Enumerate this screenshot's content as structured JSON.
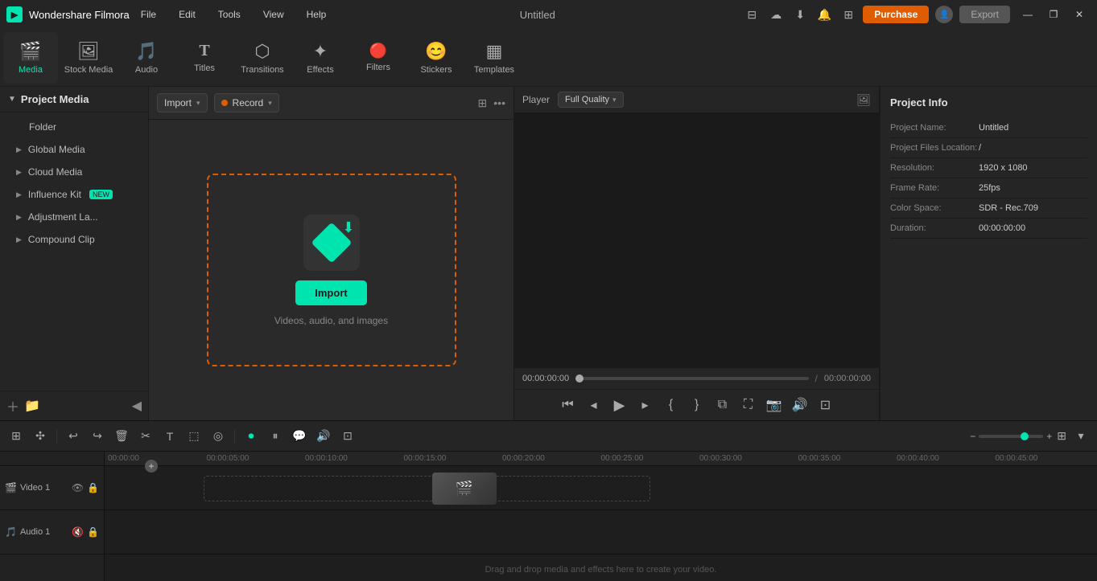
{
  "app": {
    "name": "Wondershare Filmora",
    "title": "Untitled"
  },
  "titlebar": {
    "menu": [
      "File",
      "Edit",
      "Tools",
      "View",
      "Help"
    ],
    "purchase_label": "Purchase",
    "export_label": "Export",
    "window_controls": [
      "—",
      "❐",
      "✕"
    ]
  },
  "toolbar": {
    "items": [
      {
        "id": "media",
        "icon": "🎬",
        "label": "Media",
        "active": true
      },
      {
        "id": "stock-media",
        "icon": "🖼",
        "label": "Stock Media",
        "active": false
      },
      {
        "id": "audio",
        "icon": "🎵",
        "label": "Audio",
        "active": false
      },
      {
        "id": "titles",
        "icon": "T",
        "label": "Titles",
        "active": false
      },
      {
        "id": "transitions",
        "icon": "⬡",
        "label": "Transitions",
        "active": false
      },
      {
        "id": "effects",
        "icon": "✦",
        "label": "Effects",
        "active": false
      },
      {
        "id": "filters",
        "icon": "🔴",
        "label": "Filters",
        "active": false
      },
      {
        "id": "stickers",
        "icon": "😊",
        "label": "Stickers",
        "active": false
      },
      {
        "id": "templates",
        "icon": "▦",
        "label": "Templates",
        "active": false
      }
    ]
  },
  "left_panel": {
    "title": "Project Media",
    "items": [
      {
        "label": "Folder",
        "type": "plain"
      },
      {
        "label": "Global Media",
        "type": "expandable"
      },
      {
        "label": "Cloud Media",
        "type": "expandable"
      },
      {
        "label": "Influence Kit",
        "type": "expandable",
        "badge": "NEW"
      },
      {
        "label": "Adjustment La...",
        "type": "expandable"
      },
      {
        "label": "Compound Clip",
        "type": "expandable"
      }
    ],
    "footer_icons": [
      "+",
      "📁",
      "◀"
    ]
  },
  "media_area": {
    "import_label": "Import",
    "record_label": "Record",
    "drop_zone": {
      "import_btn": "Import",
      "hint": "Videos, audio, and images"
    }
  },
  "player": {
    "label": "Player",
    "quality": "Full Quality",
    "time_current": "00:00:00:00",
    "time_total": "00:00:00:00"
  },
  "project_info": {
    "title": "Project Info",
    "fields": [
      {
        "label": "Project Name:",
        "value": "Untitled"
      },
      {
        "label": "Project Files Location:",
        "value": "/"
      },
      {
        "label": "Resolution:",
        "value": "1920 x 1080"
      },
      {
        "label": "Frame Rate:",
        "value": "25fps"
      },
      {
        "label": "Color Space:",
        "value": "SDR - Rec.709"
      },
      {
        "label": "Duration:",
        "value": "00:00:00:00"
      }
    ]
  },
  "timeline": {
    "ruler_marks": [
      "00:00:00",
      "00:00:05:00",
      "00:00:10:00",
      "00:00:15:00",
      "00:00:20:00",
      "00:00:25:00",
      "00:00:30:00",
      "00:00:35:00",
      "00:00:40:00",
      "00:00:45:00"
    ],
    "tracks": [
      {
        "label": "Video 1",
        "type": "video"
      },
      {
        "label": "Audio 1",
        "type": "audio"
      }
    ],
    "drag_hint": "Drag and drop media and effects here to create your video."
  }
}
